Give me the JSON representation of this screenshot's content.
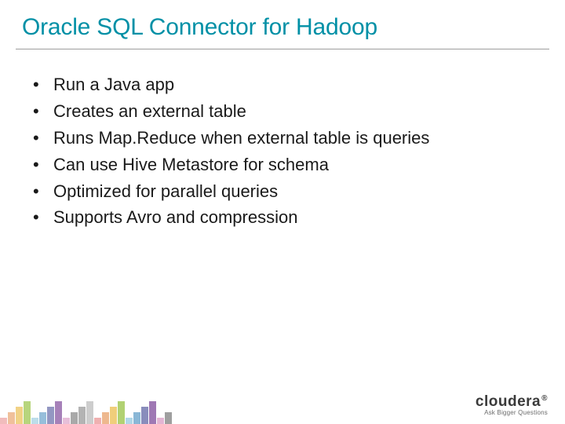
{
  "title": "Oracle SQL Connector for Hadoop",
  "bullets": [
    "Run a Java app",
    "Creates an external table",
    "Runs Map.Reduce when external table is queries",
    "Can use Hive Metastore for schema",
    "Optimized for parallel queries",
    "Supports Avro and compression"
  ],
  "footer": {
    "brand": "cloudera",
    "registered": "®",
    "tagline": "Ask Bigger Questions"
  },
  "colors": {
    "accent": "#0090a6",
    "palette": [
      "#d73f3f",
      "#e07b2e",
      "#e8b63a",
      "#9ec64f",
      "#4aa3c7",
      "#2e7eb5",
      "#545a9e",
      "#8a5aa3",
      "#c25a9e",
      "#5a5a5a",
      "#8a8a8a",
      "#bfbfbf"
    ]
  }
}
